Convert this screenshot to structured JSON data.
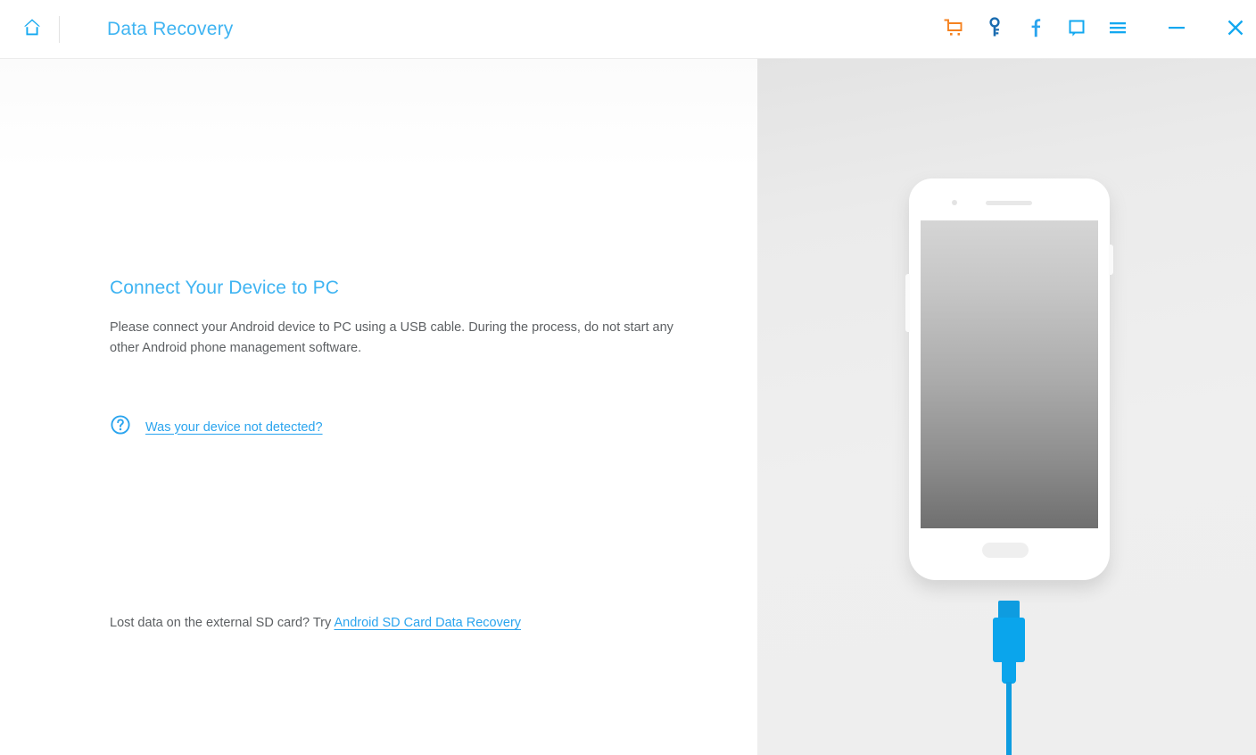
{
  "window": {
    "title": "Data Recovery",
    "home_icon": "home-icon",
    "controls": [
      {
        "name": "cart-icon",
        "label": "Buy",
        "color": "#f58220"
      },
      {
        "name": "key-icon",
        "label": "Register",
        "color": "#1a6cb0"
      },
      {
        "name": "facebook-icon",
        "label": "Facebook",
        "color": "#2aa4ee"
      },
      {
        "name": "chat-icon",
        "label": "Feedback",
        "color": "#12a8f0"
      },
      {
        "name": "menu-icon",
        "label": "Menu",
        "color": "#12a8f0"
      },
      {
        "name": "minimize-icon",
        "label": "Minimize",
        "color": "#12a8f0"
      },
      {
        "name": "close-icon",
        "label": "Close",
        "color": "#12a8f0"
      }
    ]
  },
  "main": {
    "headline": "Connect Your Device to PC",
    "body": "Please connect your Android device to PC using a USB cable. During the process, do not start any other Android phone management software.",
    "detect_icon": "question-circle-icon",
    "detect_link": "Was your device not detected?",
    "sd_prefix": "Lost data on the external SD card? Try ",
    "sd_link": "Android SD Card Data Recovery"
  },
  "illustration": {
    "device": "android-phone",
    "cable": "usb-cable"
  },
  "colors": {
    "accent_blue": "#3fb4f2",
    "link_blue": "#2aa4ee",
    "cart_orange": "#f58220",
    "key_blue": "#1a6cb0",
    "cable_blue": "#0aa5ec",
    "body_text": "#5d6063",
    "panel_bg": "#eeeeee"
  }
}
